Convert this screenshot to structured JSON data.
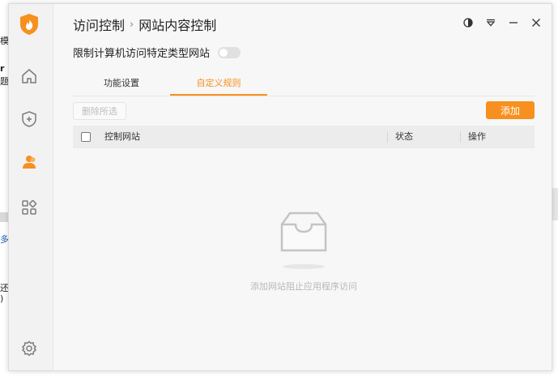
{
  "background": {
    "fragments": [
      "模",
      "r",
      "题",
      "♪",
      "多",
      "还",
      ")"
    ]
  },
  "header": {
    "breadcrumb_parent": "访问控制",
    "breadcrumb_separator": "›",
    "title": "网站内容控制"
  },
  "restriction": {
    "label": "限制计算机访问特定类型网站",
    "enabled": false
  },
  "tabs": [
    {
      "label": "功能设置",
      "active": false
    },
    {
      "label": "自定义规则",
      "active": true
    }
  ],
  "toolbar": {
    "delete_selected_label": "删除所选",
    "add_label": "添加"
  },
  "table": {
    "columns": [
      "控制网站",
      "状态",
      "操作"
    ]
  },
  "empty_state": {
    "message": "添加网站阻止应用程序访问"
  },
  "sidebar": {
    "items": [
      {
        "icon": "home-icon",
        "active": false
      },
      {
        "icon": "shield-plus-icon",
        "active": false
      },
      {
        "icon": "user-icon",
        "active": true
      },
      {
        "icon": "apps-grid-icon",
        "active": false
      },
      {
        "icon": "settings-gear-icon",
        "active": false
      }
    ]
  },
  "colors": {
    "accent": "#f7901e",
    "sidebar_bg": "#f2f2f2",
    "window_bg": "#f7f7f7"
  }
}
